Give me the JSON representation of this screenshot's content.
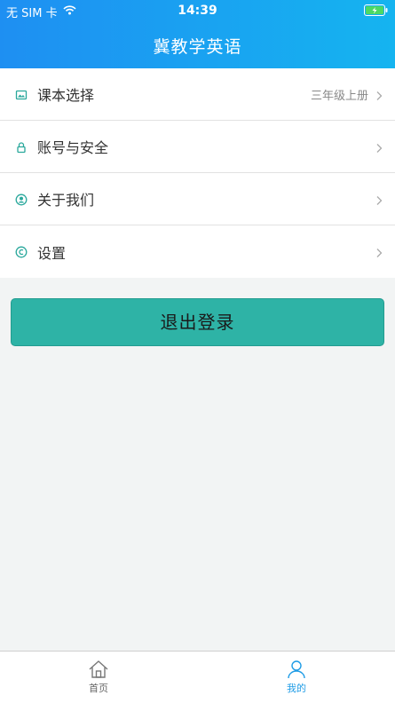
{
  "status_bar": {
    "carrier": "无 SIM 卡",
    "time": "14:39"
  },
  "header": {
    "title": "冀教学英语"
  },
  "menu": {
    "items": [
      {
        "label": "课本选择",
        "value": "三年级上册",
        "icon": "textbook-icon"
      },
      {
        "label": "账号与安全",
        "value": "",
        "icon": "lock-icon"
      },
      {
        "label": "关于我们",
        "value": "",
        "icon": "user-circle-icon"
      },
      {
        "label": "设置",
        "value": "",
        "icon": "settings-icon"
      }
    ]
  },
  "logout_label": "退出登录",
  "tabbar": {
    "tabs": [
      {
        "label": "首页",
        "icon": "home-icon",
        "active": false
      },
      {
        "label": "我的",
        "icon": "person-icon",
        "active": true
      }
    ]
  },
  "colors": {
    "header_gradient_start": "#1e8ff2",
    "header_gradient_end": "#15b4f0",
    "icon_teal": "#2aa89c",
    "logout_button": "#2eb3a6",
    "active_tab": "#1f9ce6",
    "battery_green": "#4cd964"
  }
}
